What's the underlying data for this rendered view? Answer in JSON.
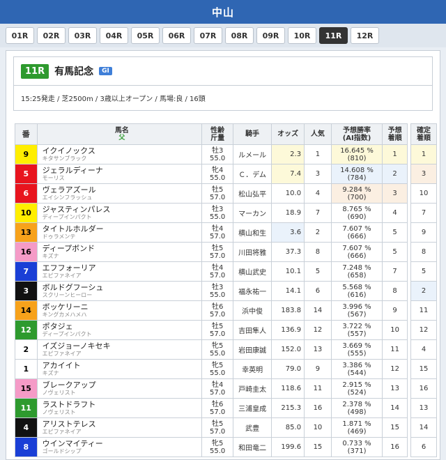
{
  "header": {
    "venue": "中山"
  },
  "tabs": [
    "01R",
    "02R",
    "03R",
    "04R",
    "05R",
    "06R",
    "07R",
    "08R",
    "09R",
    "10R",
    "11R",
    "12R"
  ],
  "active_tab": 10,
  "race": {
    "number": "11R",
    "name": "有馬記念",
    "grade": "GI",
    "info": "15:25発走 / 芝2500m / 3歳以上オープン / 馬場:良 / 16頭"
  },
  "columns": {
    "num": "番",
    "horse": "馬名",
    "sire": "父",
    "age1": "性齢",
    "age2": "斤量",
    "jockey": "騎手",
    "odds": "オッズ",
    "pop": "人気",
    "rate1": "予想勝率",
    "rate2": "(AI指数)",
    "pred1": "予想",
    "pred2": "着順",
    "final1": "確定",
    "final2": "着順"
  },
  "colors": {
    "venue_bar": "#2f66b3",
    "race_badge": "#2e9a2e",
    "grade_badge": "#3f7fd8"
  },
  "rows": [
    {
      "num": "9",
      "bg": "#ffee00",
      "fg": "#000",
      "name": "イクイノックス",
      "sire": "キタサンブラック",
      "sex": "牡3",
      "weight": "55.0",
      "jockey": "ルメール",
      "odds": "2.3",
      "pop": "1",
      "rate": "16.645 %",
      "ai": "(810)",
      "pred": "1",
      "final": "1",
      "hl_odds": "y1",
      "hl_rate": "y1",
      "hl_pred": "y1",
      "hl_final": "y1"
    },
    {
      "num": "5",
      "bg": "#e8141e",
      "fg": "#fff",
      "name": "ジェラルディーナ",
      "sire": "モーリス",
      "sex": "牝4",
      "weight": "55.0",
      "jockey": "Ｃ．デム",
      "odds": "7.4",
      "pop": "3",
      "rate": "14.608 %",
      "ai": "(784)",
      "pred": "2",
      "final": "3",
      "hl_odds": "y1",
      "hl_rate": "y2",
      "hl_pred": "y2",
      "hl_final": "y3"
    },
    {
      "num": "6",
      "bg": "#e8141e",
      "fg": "#fff",
      "name": "ヴェラアズール",
      "sire": "エイシンフラッシュ",
      "sex": "牡5",
      "weight": "57.0",
      "jockey": "松山弘平",
      "odds": "10.0",
      "pop": "4",
      "rate": "9.284 %",
      "ai": "(700)",
      "pred": "3",
      "final": "10",
      "hl_odds": "",
      "hl_rate": "y3",
      "hl_pred": "y3",
      "hl_final": ""
    },
    {
      "num": "10",
      "bg": "#ffee00",
      "fg": "#000",
      "name": "ジャスティンパレス",
      "sire": "ディープインパクト",
      "sex": "牡3",
      "weight": "55.0",
      "jockey": "マーカン",
      "odds": "18.9",
      "pop": "7",
      "rate": "8.765 %",
      "ai": "(690)",
      "pred": "4",
      "final": "7",
      "hl_odds": "",
      "hl_rate": "",
      "hl_pred": "",
      "hl_final": ""
    },
    {
      "num": "13",
      "bg": "#f7a21b",
      "fg": "#000",
      "name": "タイトルホルダー",
      "sire": "ドゥラメンテ",
      "sex": "牡4",
      "weight": "57.0",
      "jockey": "横山和生",
      "odds": "3.6",
      "pop": "2",
      "rate": "7.607 %",
      "ai": "(666)",
      "pred": "5",
      "final": "9",
      "hl_odds": "y2",
      "hl_rate": "",
      "hl_pred": "",
      "hl_final": ""
    },
    {
      "num": "16",
      "bg": "#f59bc7",
      "fg": "#000",
      "name": "ディープボンド",
      "sire": "キズナ",
      "sex": "牡5",
      "weight": "57.0",
      "jockey": "川田将雅",
      "odds": "37.3",
      "pop": "8",
      "rate": "7.607 %",
      "ai": "(666)",
      "pred": "5",
      "final": "8",
      "hl_odds": "",
      "hl_rate": "",
      "hl_pred": "",
      "hl_final": ""
    },
    {
      "num": "7",
      "bg": "#1a3fd6",
      "fg": "#fff",
      "name": "エフフォーリア",
      "sire": "エピファネイア",
      "sex": "牡4",
      "weight": "57.0",
      "jockey": "横山武史",
      "odds": "10.1",
      "pop": "5",
      "rate": "7.248 %",
      "ai": "(658)",
      "pred": "7",
      "final": "5",
      "hl_odds": "",
      "hl_rate": "",
      "hl_pred": "",
      "hl_final": ""
    },
    {
      "num": "3",
      "bg": "#111111",
      "fg": "#fff",
      "name": "ボルドグフーシュ",
      "sire": "スクリーンヒーロー",
      "sex": "牡3",
      "weight": "55.0",
      "jockey": "福永祐一",
      "odds": "14.1",
      "pop": "6",
      "rate": "5.568 %",
      "ai": "(616)",
      "pred": "8",
      "final": "2",
      "hl_odds": "",
      "hl_rate": "",
      "hl_pred": "",
      "hl_final": "y2"
    },
    {
      "num": "14",
      "bg": "#f7a21b",
      "fg": "#000",
      "name": "ボッケリーニ",
      "sire": "キングカメハメハ",
      "sex": "牡6",
      "weight": "57.0",
      "jockey": "浜中俊",
      "odds": "183.8",
      "pop": "14",
      "rate": "3.996 %",
      "ai": "(567)",
      "pred": "9",
      "final": "11",
      "hl_odds": "",
      "hl_rate": "",
      "hl_pred": "",
      "hl_final": ""
    },
    {
      "num": "12",
      "bg": "#2e9a2e",
      "fg": "#fff",
      "name": "ポタジェ",
      "sire": "ディープインパクト",
      "sex": "牡5",
      "weight": "57.0",
      "jockey": "吉田隼人",
      "odds": "136.9",
      "pop": "12",
      "rate": "3.722 %",
      "ai": "(557)",
      "pred": "10",
      "final": "12",
      "hl_odds": "",
      "hl_rate": "",
      "hl_pred": "",
      "hl_final": ""
    },
    {
      "num": "2",
      "bg": "#ffffff",
      "fg": "#000",
      "name": "イズジョーノキセキ",
      "sire": "エピファネイア",
      "sex": "牝5",
      "weight": "55.0",
      "jockey": "岩田康誠",
      "odds": "152.0",
      "pop": "13",
      "rate": "3.669 %",
      "ai": "(555)",
      "pred": "11",
      "final": "4",
      "hl_odds": "",
      "hl_rate": "",
      "hl_pred": "",
      "hl_final": ""
    },
    {
      "num": "1",
      "bg": "#ffffff",
      "fg": "#000",
      "name": "アカイイト",
      "sire": "キズナ",
      "sex": "牝5",
      "weight": "55.0",
      "jockey": "幸英明",
      "odds": "79.0",
      "pop": "9",
      "rate": "3.386 %",
      "ai": "(544)",
      "pred": "12",
      "final": "15",
      "hl_odds": "",
      "hl_rate": "",
      "hl_pred": "",
      "hl_final": ""
    },
    {
      "num": "15",
      "bg": "#f59bc7",
      "fg": "#000",
      "name": "ブレークアップ",
      "sire": "ノヴェリスト",
      "sex": "牡4",
      "weight": "57.0",
      "jockey": "戸崎圭太",
      "odds": "118.6",
      "pop": "11",
      "rate": "2.915 %",
      "ai": "(524)",
      "pred": "13",
      "final": "16",
      "hl_odds": "",
      "hl_rate": "",
      "hl_pred": "",
      "hl_final": ""
    },
    {
      "num": "11",
      "bg": "#2e9a2e",
      "fg": "#fff",
      "name": "ラストドラフト",
      "sire": "ノヴェリスト",
      "sex": "牡6",
      "weight": "57.0",
      "jockey": "三浦皇成",
      "odds": "215.3",
      "pop": "16",
      "rate": "2.378 %",
      "ai": "(498)",
      "pred": "14",
      "final": "13",
      "hl_odds": "",
      "hl_rate": "",
      "hl_pred": "",
      "hl_final": ""
    },
    {
      "num": "4",
      "bg": "#111111",
      "fg": "#fff",
      "name": "アリストテレス",
      "sire": "エピファネイア",
      "sex": "牡5",
      "weight": "57.0",
      "jockey": "武豊",
      "odds": "85.0",
      "pop": "10",
      "rate": "1.871 %",
      "ai": "(469)",
      "pred": "15",
      "final": "14",
      "hl_odds": "",
      "hl_rate": "",
      "hl_pred": "",
      "hl_final": ""
    },
    {
      "num": "8",
      "bg": "#1a3fd6",
      "fg": "#fff",
      "name": "ウインマイティー",
      "sire": "ゴールドシップ",
      "sex": "牝5",
      "weight": "55.0",
      "jockey": "和田竜二",
      "odds": "199.6",
      "pop": "15",
      "rate": "0.733 %",
      "ai": "(371)",
      "pred": "16",
      "final": "6",
      "hl_odds": "",
      "hl_rate": "",
      "hl_pred": "",
      "hl_final": ""
    }
  ]
}
